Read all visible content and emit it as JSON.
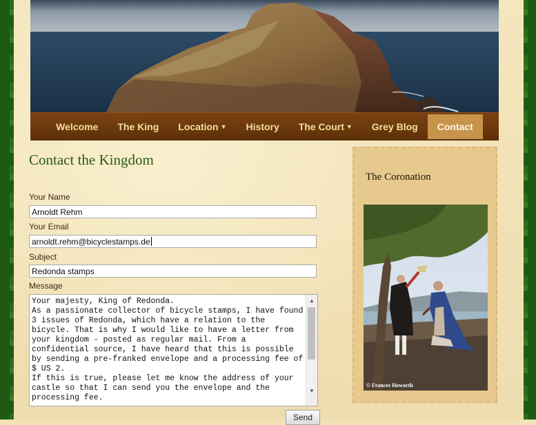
{
  "nav": {
    "items": [
      {
        "label": "Welcome",
        "dropdown": false
      },
      {
        "label": "The King",
        "dropdown": false
      },
      {
        "label": "Location",
        "dropdown": true
      },
      {
        "label": "History",
        "dropdown": false
      },
      {
        "label": "The Court",
        "dropdown": true
      },
      {
        "label": "Grey Blog",
        "dropdown": false
      },
      {
        "label": "Contact",
        "dropdown": false,
        "active": true
      }
    ]
  },
  "main": {
    "title": "Contact the Kingdom",
    "form": {
      "name_label": "Your Name",
      "name_value": "Arnoldt Rehm",
      "email_label": "Your Email",
      "email_value": "arnoldt.rehm@bicyclestamps.de",
      "subject_label": "Subject",
      "subject_value": "Redonda stamps",
      "message_label": "Message",
      "message_value": "Your majesty, King of Redonda.\nAs a passionate collector of bicycle stamps, I have found 3 issues of Redonda, which have a relation to the bicycle. That is why I would like to have a letter from your kingdom - posted as regular mail. From a confidential source, I have heard that this is possible by sending a pre-franked envelope and a processing fee of $ US 2.\nIf this is true, please let me know the address of your castle so that I can send you the envelope and the processing fee.",
      "send_label": "Send"
    }
  },
  "sidebar": {
    "title": "The Coronation",
    "photo_credit": "© Frances Howorth"
  },
  "colors": {
    "nav_bg": "#6a380c",
    "nav_text": "#f4df9a",
    "nav_active": "#c8934b",
    "title": "#2d5a12",
    "page_bg": "#f1e2b8",
    "sidebar_bg": "#e8c98d",
    "edge": "#1f5a12"
  }
}
